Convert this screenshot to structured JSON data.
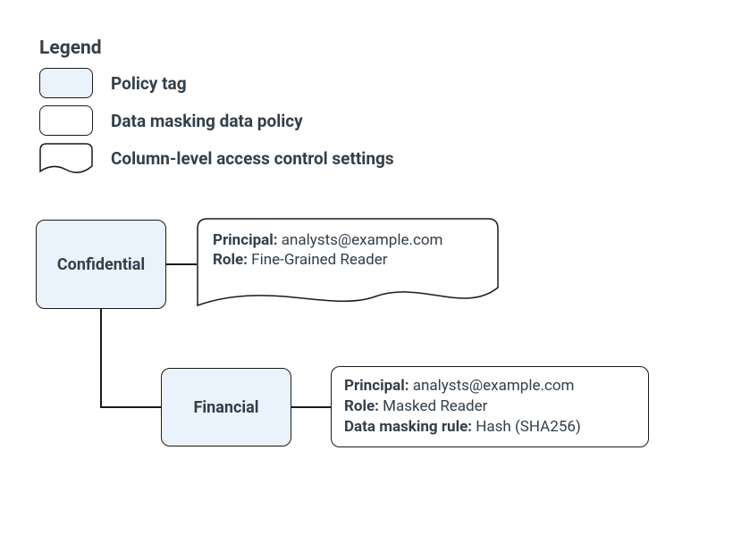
{
  "legend": {
    "title": "Legend",
    "items": [
      {
        "label": "Policy tag"
      },
      {
        "label": "Data masking data policy"
      },
      {
        "label": "Column-level access control settings"
      }
    ]
  },
  "diagram": {
    "confidential": {
      "tag": "Confidential",
      "acl": {
        "principal_label": "Principal:",
        "principal_value": " analysts@example.com",
        "role_label": "Role:",
        "role_value": " Fine-Grained Reader"
      }
    },
    "financial": {
      "tag": "Financial",
      "policy": {
        "principal_label": "Principal:",
        "principal_value": " analysts@example.com",
        "role_label": "Role:",
        "role_value": " Masked Reader",
        "rule_label": "Data masking rule:",
        "rule_value": " Hash (SHA256)"
      }
    }
  }
}
